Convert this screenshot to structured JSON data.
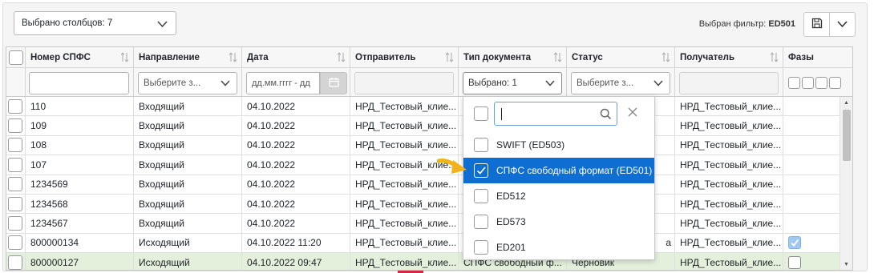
{
  "toolbar": {
    "columns_select_label": "Выбрано столбцов: 7",
    "filter_prefix": "Выбран фильтр:",
    "filter_value": "ED501"
  },
  "columns": [
    {
      "label": "Номер СПФС"
    },
    {
      "label": "Направление"
    },
    {
      "label": "Дата"
    },
    {
      "label": "Отправитель"
    },
    {
      "label": "Тип документа"
    },
    {
      "label": "Статус"
    },
    {
      "label": "Получатель"
    },
    {
      "label": "Фазы"
    }
  ],
  "filters": {
    "direction_placeholder": "Выберите з...",
    "date_placeholder": "дд.мм.гггг - дд",
    "doctype_value": "Выбрано: 1",
    "status_placeholder": "Выберите з..."
  },
  "rows": [
    {
      "num": "110",
      "dir": "Входящий",
      "date": "04.10.2022",
      "sender": "НРД_Тестовый_клие...",
      "doctype": "",
      "status": "",
      "receiver": "НРД_Тестовый_клие...",
      "phase": "none"
    },
    {
      "num": "109",
      "dir": "Входящий",
      "date": "04.10.2022",
      "sender": "НРД_Тестовый_клие...",
      "doctype": "",
      "status": "",
      "receiver": "НРД_Тестовый_клие...",
      "phase": "none"
    },
    {
      "num": "108",
      "dir": "Входящий",
      "date": "04.10.2022",
      "sender": "НРД_Тестовый_клие...",
      "doctype": "",
      "status": "",
      "receiver": "НРД_Тестовый_клие...",
      "phase": "none"
    },
    {
      "num": "107",
      "dir": "Входящий",
      "date": "04.10.2022",
      "sender": "НРД_Тестовый_клие...",
      "doctype": "",
      "status": "",
      "receiver": "НРД_Тестовый_клие...",
      "phase": "none"
    },
    {
      "num": "1234569",
      "dir": "Входящий",
      "date": "04.10.2022",
      "sender": "НРД_Тестовый_клие...",
      "doctype": "",
      "status": "",
      "receiver": "НРД_Тестовый_клие...",
      "phase": "none"
    },
    {
      "num": "1234568",
      "dir": "Входящий",
      "date": "04.10.2022",
      "sender": "НРД_Тестовый_клие...",
      "doctype": "",
      "status": "",
      "receiver": "НРД_Тестовый_клие...",
      "phase": "none"
    },
    {
      "num": "1234567",
      "dir": "Входящий",
      "date": "04.10.2022",
      "sender": "НРД_Тестовый_клие...",
      "doctype": "",
      "status": "",
      "receiver": "НРД_Тестовый_клие...",
      "phase": "none"
    },
    {
      "num": "800000134",
      "dir": "Исходящий",
      "date": "04.10.2022 11:20",
      "sender": "НРД_Тестовый_клие...",
      "doctype": "",
      "status": "а",
      "receiver": "НРД_Тестовый_клие...",
      "phase": "checked"
    },
    {
      "num": "800000127",
      "dir": "Исходящий",
      "date": "04.10.2022 09:47",
      "sender": "НРД_Тестовый_клие...",
      "doctype": "СПФС свободный ф...",
      "status": "Черновик",
      "receiver": "НРД_Тестовый_клие...",
      "phase": "unchecked"
    }
  ],
  "dropdown": {
    "search_value": "",
    "options": [
      {
        "label": "SWIFT (ED503)",
        "selected": false
      },
      {
        "label": "СПФС свободный формат (ED501)",
        "selected": true
      },
      {
        "label": "ED512",
        "selected": false
      },
      {
        "label": "ED573",
        "selected": false
      },
      {
        "label": "ED201",
        "selected": false
      }
    ]
  },
  "icons": [
    "chevron-down-icon",
    "floppy-disk-icon",
    "sort-icon",
    "calendar-icon",
    "search-icon",
    "close-icon",
    "checkmark-icon",
    "pointer-arrow-icon"
  ],
  "colors": {
    "selected_option": "#0f6ed2",
    "highlight_row": "#e3f1dc",
    "pointer": "#f2b21a",
    "phase_checked": "#9fc9f0"
  }
}
